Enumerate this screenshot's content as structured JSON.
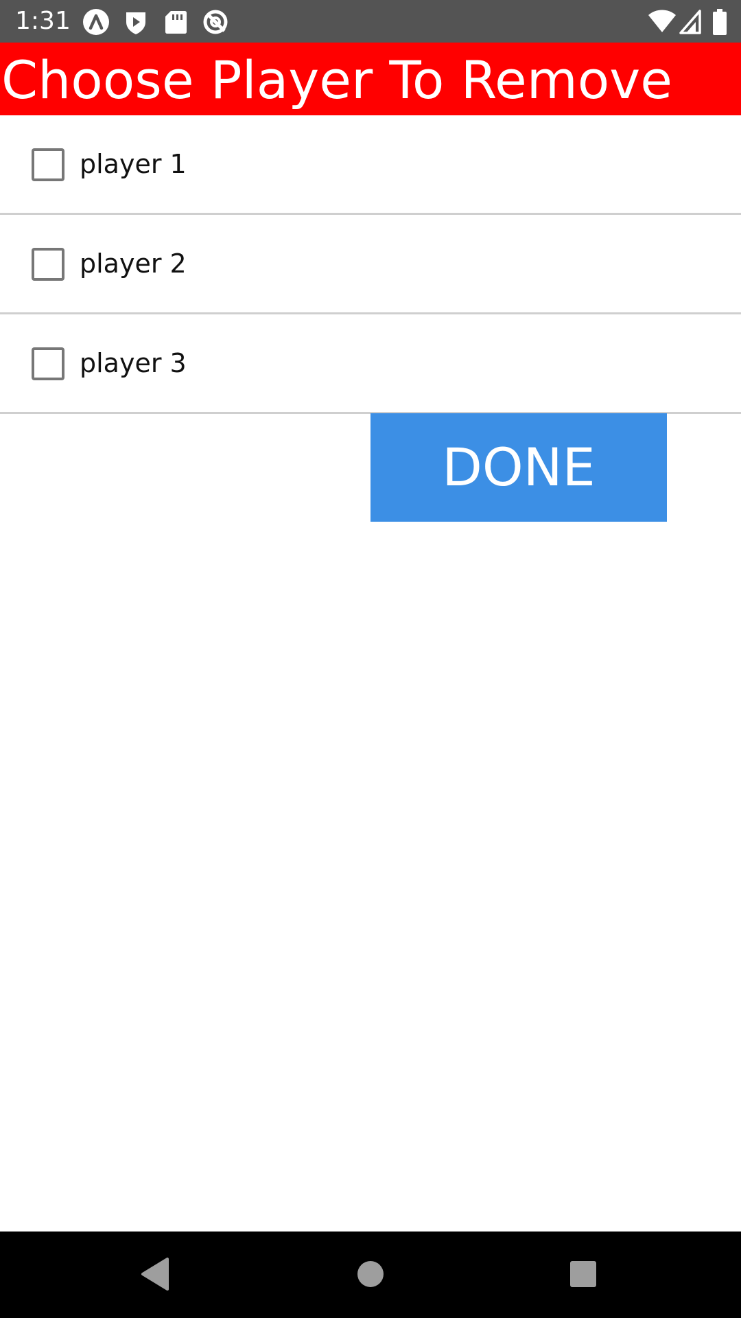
{
  "status_bar": {
    "time": "1:31",
    "left_icons": [
      "launcher-a-icon",
      "shield-play-icon",
      "sd-card-icon",
      "no-sync-icon"
    ],
    "right_icons": [
      "wifi-icon",
      "cell-signal-icon",
      "battery-icon"
    ],
    "background": "#545454"
  },
  "header": {
    "title": "Choose Player To Remove",
    "background": "#ff0000"
  },
  "players": [
    {
      "label": "player 1",
      "checked": false
    },
    {
      "label": "player 2",
      "checked": false
    },
    {
      "label": "player 3",
      "checked": false
    }
  ],
  "done_button": {
    "label": "DONE",
    "background": "#3c8fe5"
  },
  "nav_bar": {
    "icons": [
      "back-icon",
      "home-icon",
      "recents-icon"
    ]
  }
}
